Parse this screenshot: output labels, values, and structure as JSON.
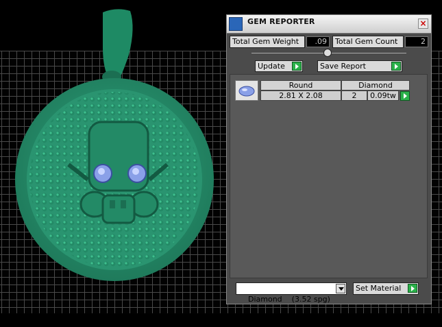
{
  "panel": {
    "title": "GEM REPORTER",
    "close_label": "×",
    "total_gem_weight_label": "Total Gem Weight",
    "total_gem_weight_value": ".09",
    "total_gem_count_label": "Total Gem Count",
    "total_gem_count_value": "2",
    "update_label": "Update",
    "save_report_label": "Save Report"
  },
  "gem_table": {
    "shape_header": "Round",
    "material_header": "Diamond",
    "row": {
      "size": "2.81 X 2.08",
      "count": "2",
      "weight": "0.09tw"
    }
  },
  "material_select": {
    "selected": "Diamond    (3.52 spg)"
  },
  "set_material_label": "Set Material",
  "colors": {
    "model": "#2fa07a",
    "panel_bg": "#4b4b4b",
    "go_button": "#2bb14a",
    "gem_eye": "#8aa0e8"
  }
}
